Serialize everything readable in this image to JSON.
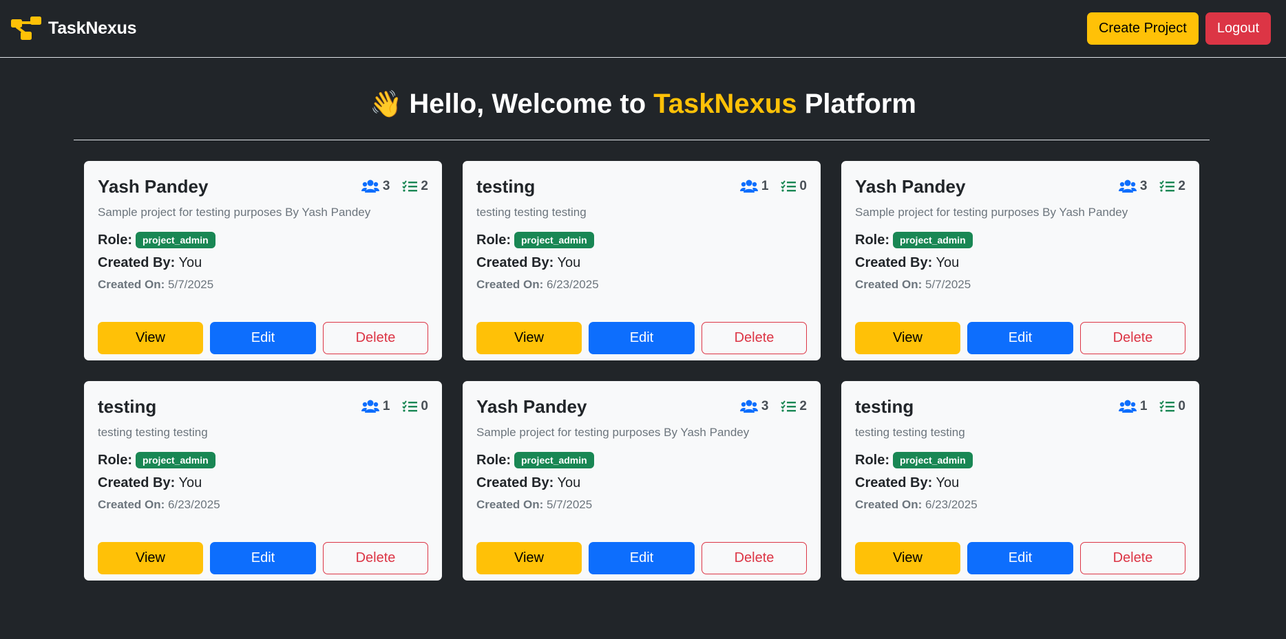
{
  "app": {
    "name": "TaskNexus"
  },
  "nav": {
    "create_label": "Create Project",
    "logout_label": "Logout"
  },
  "welcome": {
    "wave": "👋",
    "before": "Hello, Welcome to",
    "brand": "TaskNexus",
    "after": "Platform"
  },
  "labels": {
    "role": "Role:",
    "created_by": "Created By:",
    "created_on": "Created On:",
    "view": "View",
    "edit": "Edit",
    "delete": "Delete"
  },
  "colors": {
    "accent": "#ffc107",
    "danger": "#dc3545",
    "primary": "#0d6efd",
    "success": "#198754",
    "background": "#212529"
  },
  "projects": [
    {
      "title": "Yash Pandey",
      "members": "3",
      "tasks": "2",
      "description": "Sample project for testing purposes By Yash Pandey",
      "role": "project_admin",
      "created_by": "You",
      "created_on": "5/7/2025"
    },
    {
      "title": "testing",
      "members": "1",
      "tasks": "0",
      "description": "testing testing testing",
      "role": "project_admin",
      "created_by": "You",
      "created_on": "6/23/2025"
    },
    {
      "title": "Yash Pandey",
      "members": "3",
      "tasks": "2",
      "description": "Sample project for testing purposes By Yash Pandey",
      "role": "project_admin",
      "created_by": "You",
      "created_on": "5/7/2025"
    },
    {
      "title": "testing",
      "members": "1",
      "tasks": "0",
      "description": "testing testing testing",
      "role": "project_admin",
      "created_by": "You",
      "created_on": "6/23/2025"
    },
    {
      "title": "Yash Pandey",
      "members": "3",
      "tasks": "2",
      "description": "Sample project for testing purposes By Yash Pandey",
      "role": "project_admin",
      "created_by": "You",
      "created_on": "5/7/2025"
    },
    {
      "title": "testing",
      "members": "1",
      "tasks": "0",
      "description": "testing testing testing",
      "role": "project_admin",
      "created_by": "You",
      "created_on": "6/23/2025"
    }
  ]
}
